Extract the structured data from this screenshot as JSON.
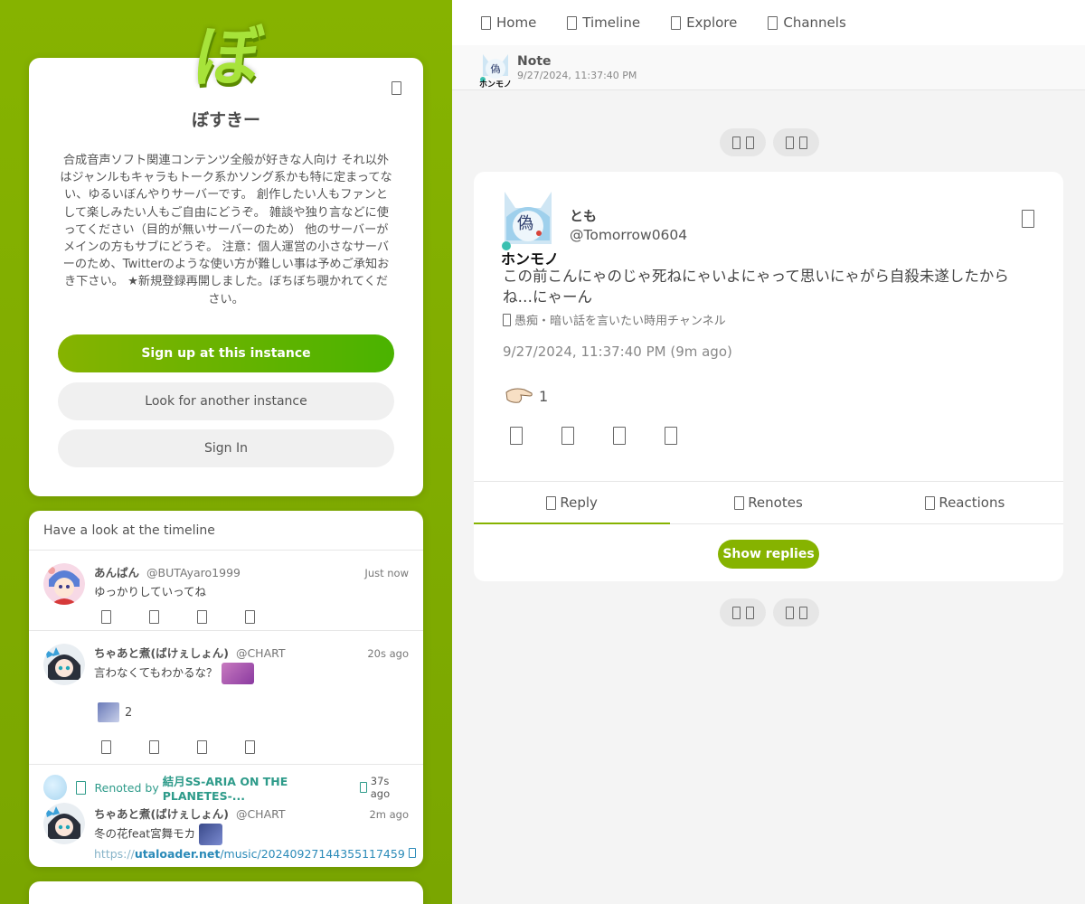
{
  "instance": {
    "logo_glyph": "ぼ",
    "name": "ぼすきー",
    "description": "合成音声ソフト関連コンテンツ全般が好きな人向け それ以外はジャンルもキャラもトーク系かソング系かも特に定まってない、ゆるいぼんやりサーバーです。 創作したい人もファンとして楽しみたい人もご自由にどうぞ。 雑談や独り言などに使ってください（目的が無いサーバーのため） 他のサーバーがメインの方もサブにどうぞ。 注意：個人運営の小さなサーバーのため、Twitterのような使い方が難しい事は予めご承知おき下さい。 ★新規登録再開しました。ぼちぼち覗かれてください。",
    "signup_label": "Sign up at this instance",
    "another_label": "Look for another instance",
    "signin_label": "Sign In",
    "brand_color": "#86b300"
  },
  "timeline": {
    "header": "Have a look at the timeline",
    "notes": [
      {
        "name": "あんぱん",
        "user": "@BUTAyaro1999",
        "time": "Just now",
        "text": "ゆっかりしていってね"
      },
      {
        "name": "ちゃあと煮(ばけぇしょん)",
        "user": "@CHART",
        "time": "20s ago",
        "text": "言わなくてもわかるな？",
        "reaction_count": "2"
      },
      {
        "renote_prefix": "Renoted by ",
        "renote_by": "結月SS-ARIA ON THE PLANETES-...",
        "renote_time": "37s ago",
        "name": "ちゃあと煮(ばけぇしょん)",
        "user": "@CHART",
        "time": "2m ago",
        "text": "冬の花feat宮舞モカ",
        "link_prefix": "https://",
        "link_host": "utaloader.net",
        "link_path": "/music/20240927144355117459"
      }
    ]
  },
  "nav": {
    "home": "Home",
    "timeline": "Timeline",
    "explore": "Explore",
    "channels": "Channels"
  },
  "subheader": {
    "title": "Note",
    "date": "9/27/2024, 11:37:40 PM"
  },
  "note": {
    "name": "とも",
    "user": "@Tomorrow0604",
    "text": "この前こんにゃのじゃ死ねにゃいよにゃって思いにゃがら自殺未遂したからね…にゃーん",
    "channel": "愚痴・暗い話を言いたい時用チャンネル",
    "date": "9/27/2024, 11:37:40 PM (9m ago)",
    "reaction_count": "1",
    "tabs": {
      "reply": "Reply",
      "renotes": "Renotes",
      "reactions": "Reactions"
    },
    "show_replies": "Show replies"
  }
}
